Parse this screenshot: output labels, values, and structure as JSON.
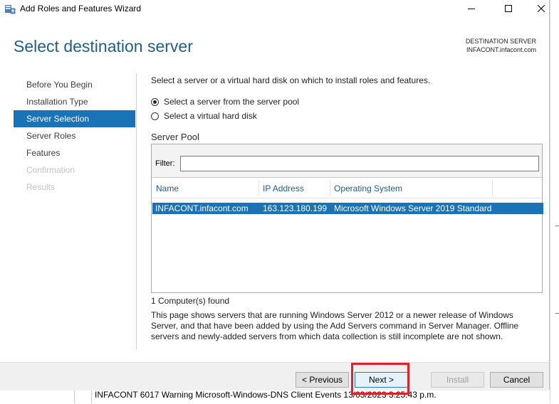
{
  "window": {
    "title": "Add Roles and Features Wizard",
    "app_icon": "server-manager-icon",
    "controls": [
      "minimize-icon",
      "maximize-icon",
      "close-icon"
    ]
  },
  "header": {
    "title": "Select destination server",
    "destination_label": "DESTINATION SERVER",
    "destination_server": "INFACONT.infacont.com"
  },
  "nav": {
    "items": [
      {
        "label": "Before You Begin",
        "state": "normal"
      },
      {
        "label": "Installation Type",
        "state": "normal"
      },
      {
        "label": "Server Selection",
        "state": "active"
      },
      {
        "label": "Server Roles",
        "state": "normal"
      },
      {
        "label": "Features",
        "state": "normal"
      },
      {
        "label": "Confirmation",
        "state": "disabled"
      },
      {
        "label": "Results",
        "state": "disabled"
      }
    ]
  },
  "main": {
    "instruction": "Select a server or a virtual hard disk on which to install roles and features.",
    "options": [
      {
        "label": "Select a server from the server pool",
        "checked": true
      },
      {
        "label": "Select a virtual hard disk",
        "checked": false
      }
    ],
    "pool_label": "Server Pool",
    "filter_label": "Filter:",
    "filter_value": "",
    "columns": [
      "Name",
      "IP Address",
      "Operating System"
    ],
    "rows": [
      {
        "name": "INFACONT.infacont.com",
        "ip": "163.123.180.199",
        "os": "Microsoft Windows Server 2019 Standard",
        "selected": true
      }
    ],
    "count_text": "1 Computer(s) found",
    "description": "This page shows servers that are running Windows Server 2012 or a newer release of Windows Server, and that have been added by using the Add Servers command in Server Manager. Offline servers and newly-added servers from which data collection is still incomplete are not shown."
  },
  "footer": {
    "previous_label": "< Previous",
    "next_label": "Next >",
    "install_label": "Install",
    "cancel_label": "Cancel"
  },
  "background_app": {
    "partial_text": "INFACONT      6017   Warning   Microsoft-Windows-DNS Client Events        13/03/2023 3:25:43 p.m."
  },
  "colors": {
    "accent": "#1a73b6",
    "title_blue": "#1f5f86",
    "highlight": "#e0202a"
  }
}
